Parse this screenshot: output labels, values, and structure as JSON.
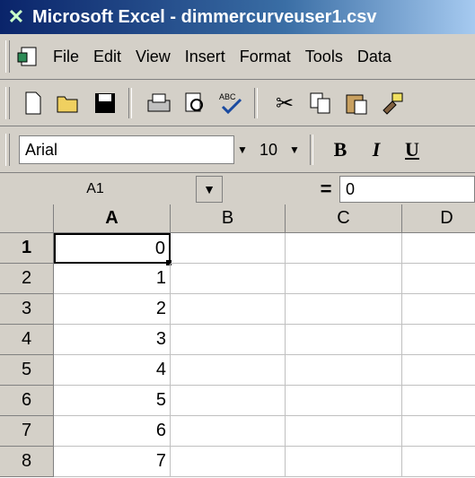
{
  "window": {
    "title": "Microsoft Excel - dimmercurveuser1.csv"
  },
  "menu": {
    "items": [
      "File",
      "Edit",
      "View",
      "Insert",
      "Format",
      "Tools",
      "Data"
    ]
  },
  "formatting": {
    "font": "Arial",
    "size": "10",
    "bold": "B",
    "italic": "I",
    "underline": "U"
  },
  "formula_bar": {
    "name_box": "A1",
    "equals": "=",
    "value": "0"
  },
  "sheet": {
    "columns": [
      "A",
      "B",
      "C",
      "D"
    ],
    "rows": [
      "1",
      "2",
      "3",
      "4",
      "5",
      "6",
      "7",
      "8"
    ],
    "colA_values": [
      "0",
      "1",
      "2",
      "3",
      "4",
      "5",
      "6",
      "7"
    ],
    "active_cell": "A1"
  }
}
